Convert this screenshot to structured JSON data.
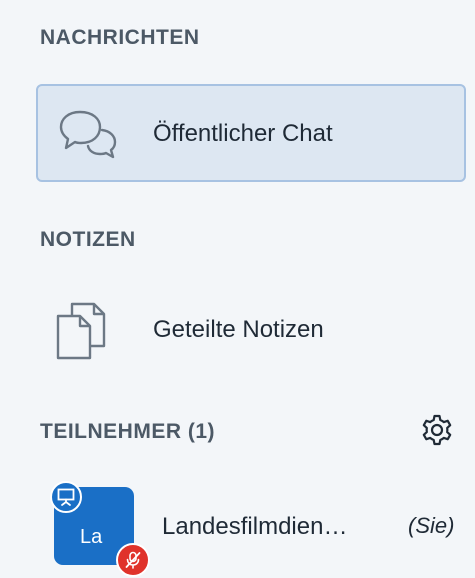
{
  "sections": {
    "messages": {
      "title": "NACHRICHTEN",
      "items": [
        {
          "label": "Öffentlicher Chat",
          "icon": "chat-bubbles-icon",
          "active": true
        }
      ]
    },
    "notes": {
      "title": "NOTIZEN",
      "items": [
        {
          "label": "Geteilte Notizen",
          "icon": "documents-icon"
        }
      ]
    },
    "participants": {
      "title": "TEILNEHMER (1)",
      "settings_icon": "gear-icon",
      "users": [
        {
          "initials": "La",
          "name": "Landesfilmdien…",
          "you_label": "(Sie)",
          "avatar_color": "#1a6fc6",
          "presenter_icon": "presenter-icon",
          "status_icon": "microphone-muted-icon",
          "status_color": "#e0332b"
        }
      ]
    }
  },
  "colors": {
    "background": "#f3f6f9",
    "active_item_bg": "#dde7f2",
    "active_item_border": "#a7c2e2",
    "section_title": "#4c5966"
  }
}
